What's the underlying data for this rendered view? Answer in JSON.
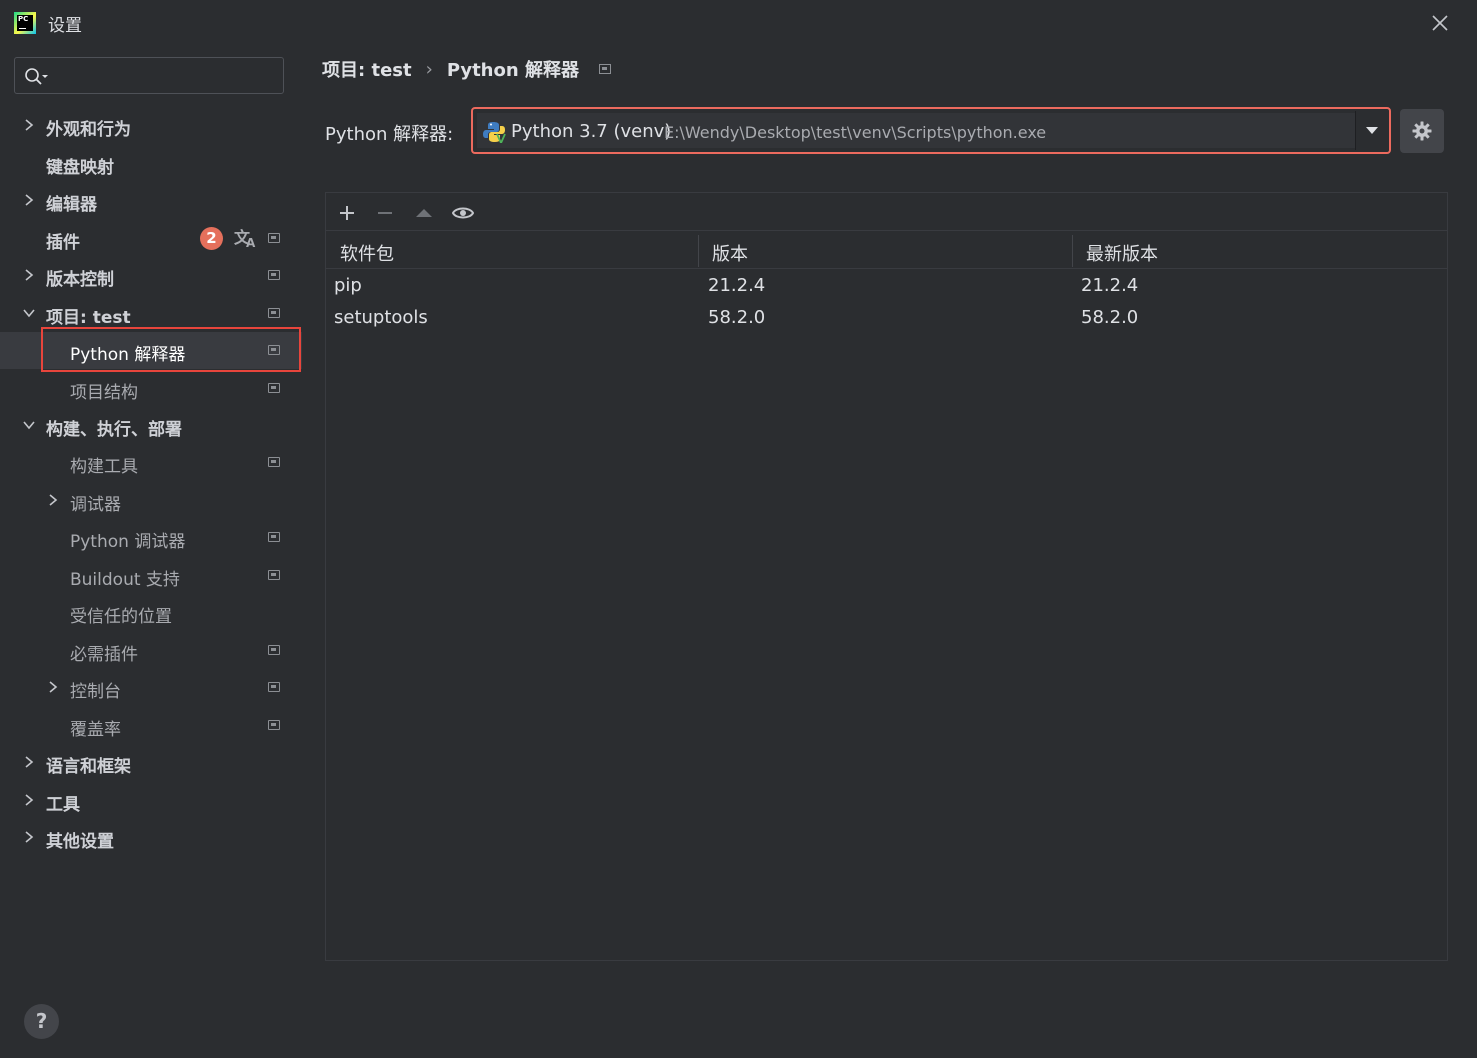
{
  "window": {
    "title": "设置"
  },
  "sidebar": {
    "search": {
      "placeholder": ""
    },
    "items": [
      {
        "label": "外观和行为"
      },
      {
        "label": "键盘映射"
      },
      {
        "label": "编辑器"
      },
      {
        "label": "插件",
        "badge": "2"
      },
      {
        "label": "版本控制"
      },
      {
        "label": "项目: test"
      },
      {
        "label": "Python 解释器"
      },
      {
        "label": "项目结构"
      },
      {
        "label": "构建、执行、部署"
      },
      {
        "label": "构建工具"
      },
      {
        "label": "调试器"
      },
      {
        "label": "Python 调试器"
      },
      {
        "label": "Buildout 支持"
      },
      {
        "label": "受信任的位置"
      },
      {
        "label": "必需插件"
      },
      {
        "label": "控制台"
      },
      {
        "label": "覆盖率"
      },
      {
        "label": "语言和框架"
      },
      {
        "label": "工具"
      },
      {
        "label": "其他设置"
      }
    ],
    "help": "?"
  },
  "breadcrumb": {
    "parent": "项目: test",
    "sep": "›",
    "current": "Python 解释器"
  },
  "interpreter": {
    "label": "Python 解释器:",
    "name": "Python 3.7 (venv)",
    "path": "E:\\Wendy\\Desktop\\test\\venv\\Scripts\\python.exe"
  },
  "packages": {
    "columns": [
      "软件包",
      "版本",
      "最新版本"
    ],
    "rows": [
      {
        "name": "pip",
        "version": "21.2.4",
        "latest": "21.2.4"
      },
      {
        "name": "setuptools",
        "version": "58.2.0",
        "latest": "58.2.0"
      }
    ]
  },
  "colors": {
    "accent_red": "#e8453c",
    "badge": "#e5705c",
    "bg": "#2b2d30"
  },
  "icons": [
    "search-icon",
    "close-icon",
    "chevron-right-icon",
    "chevron-down-icon",
    "pin-icon",
    "translate-icon",
    "python-icon",
    "dropdown-arrow-icon",
    "gear-icon",
    "add-icon",
    "remove-icon",
    "upgrade-icon",
    "eye-icon"
  ]
}
